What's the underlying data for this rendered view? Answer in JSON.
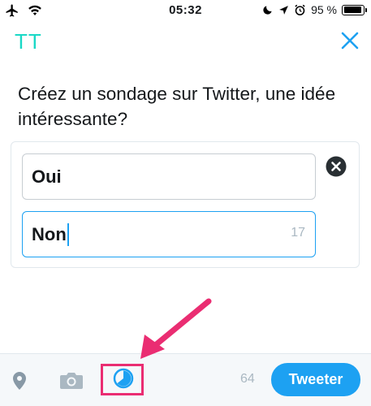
{
  "status_bar": {
    "time": "05:32",
    "battery_text": "95 %",
    "battery_level": 0.95,
    "icons": [
      "airplane-icon",
      "wifi-icon",
      "moon-icon",
      "location-arrow-icon",
      "alarm-icon",
      "battery-icon"
    ]
  },
  "header": {
    "title": "TT",
    "title_color": "#1ad8c6",
    "close_icon": "close-icon"
  },
  "question": {
    "text": "Créez un sondage sur Twitter, une idée intéressante?"
  },
  "poll": {
    "choices": [
      {
        "value": "Oui"
      },
      {
        "value": "Non",
        "char_count": "17"
      }
    ],
    "remove_icon": "remove-circle-icon"
  },
  "toolbar": {
    "icons": [
      "location-pin-icon",
      "camera-icon",
      "poll-icon"
    ],
    "remaining_count": "64",
    "tweet_label": "Tweeter",
    "accent_color": "#1da1f2"
  },
  "annotation": {
    "color": "#ea2d72"
  }
}
